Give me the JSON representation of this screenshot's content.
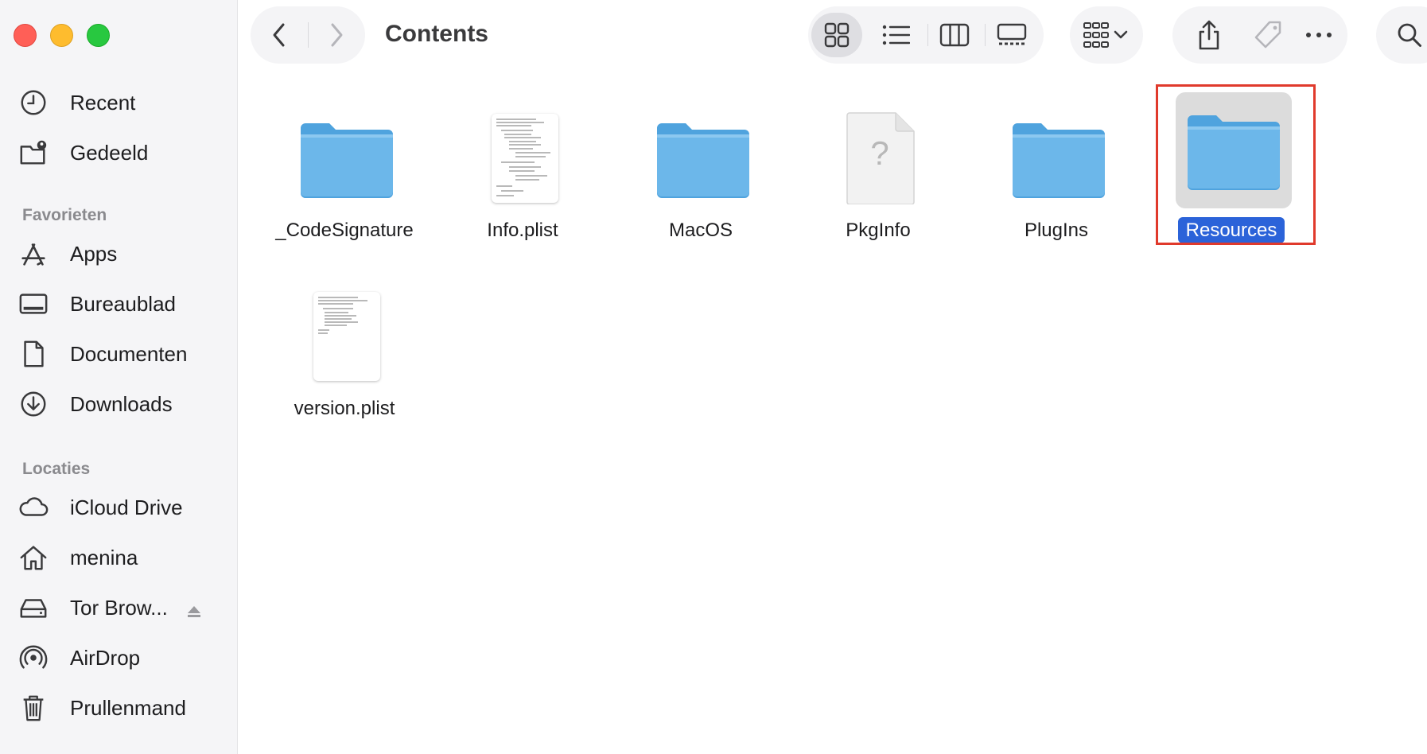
{
  "window": {
    "title": "Contents"
  },
  "sidebar": {
    "top_items": [
      {
        "label": "Recent",
        "icon": "clock-icon"
      },
      {
        "label": "Gedeeld",
        "icon": "shared-folder-icon"
      }
    ],
    "favorites_header": "Favorieten",
    "favorites": [
      {
        "label": "Apps",
        "icon": "apps-icon"
      },
      {
        "label": "Bureaublad",
        "icon": "desktop-icon"
      },
      {
        "label": "Documenten",
        "icon": "document-icon"
      },
      {
        "label": "Downloads",
        "icon": "download-icon"
      }
    ],
    "locations_header": "Locaties",
    "locations": [
      {
        "label": "iCloud Drive",
        "icon": "cloud-icon"
      },
      {
        "label": "menina",
        "icon": "home-icon"
      },
      {
        "label": "Tor Brow...",
        "icon": "drive-icon"
      },
      {
        "label": "AirDrop",
        "icon": "airdrop-icon"
      },
      {
        "label": "Prullenmand",
        "icon": "trash-icon"
      }
    ]
  },
  "items": [
    {
      "name": "_CodeSignature",
      "kind": "folder",
      "selected": false
    },
    {
      "name": "Info.plist",
      "kind": "document",
      "selected": false
    },
    {
      "name": "MacOS",
      "kind": "folder",
      "selected": false
    },
    {
      "name": "PkgInfo",
      "kind": "unknown",
      "selected": false
    },
    {
      "name": "PlugIns",
      "kind": "folder",
      "selected": false
    },
    {
      "name": "Resources",
      "kind": "folder",
      "selected": true
    },
    {
      "name": "version.plist",
      "kind": "document",
      "selected": false
    }
  ],
  "colors": {
    "folder": "#6cb7ea",
    "selection": "#2b63d9",
    "highlight_box": "#e03a2c"
  }
}
